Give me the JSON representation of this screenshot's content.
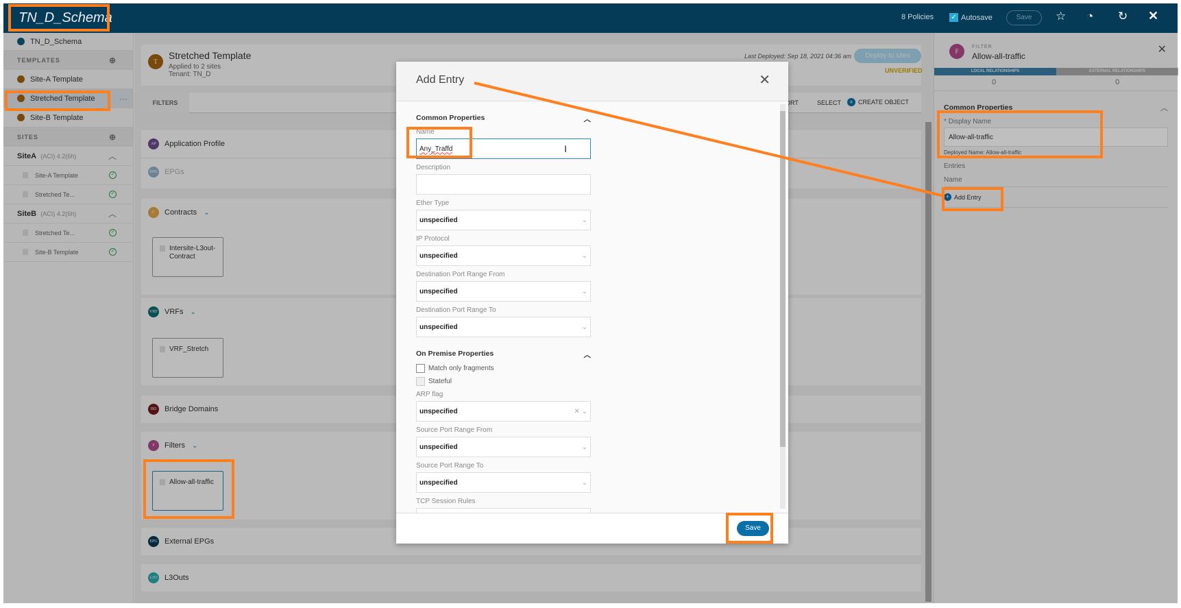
{
  "app": {
    "title": "TN_D_Schema",
    "policies": "8 Policies",
    "autosave_label": "Autosave",
    "autosave_checked": true,
    "save_label": "Save"
  },
  "sidebar": {
    "schema": "TN_D_Schema",
    "templates_header": "TEMPLATES",
    "templates": [
      "Site-A Template",
      "Stretched Template",
      "Site-B Template"
    ],
    "more": "···",
    "sites_header": "SITES",
    "sites": [
      {
        "name": "SiteA",
        "meta": "(ACI)  4.2(6h)",
        "items": [
          "Site-A Template",
          "Stretched Te..."
        ]
      },
      {
        "name": "SiteB",
        "meta": "(ACI)  4.2(6h)",
        "items": [
          "Stretched Te...",
          "Site-B Template"
        ]
      }
    ]
  },
  "main": {
    "template_title": "Stretched Template",
    "applied": "Applied to 2 sites",
    "tenant": "Tenant: TN_D",
    "avatar": "T",
    "last_deployed": "Last Deployed: Sep 18, 2021 04:36 am",
    "deploy_label": "Deploy to sites",
    "status": "UNVERIFIED",
    "tab": "FILTERS",
    "sort": "ORT",
    "select": "SELECT",
    "create": "CREATE OBJECT",
    "sections": {
      "ap": {
        "badge": "AP",
        "label": "Application Profile"
      },
      "epg": {
        "badge": "EPG",
        "label": "EPGs"
      },
      "contracts": {
        "badge": "C",
        "label": "Contracts",
        "obj": "Intersite-L3out-Contract"
      },
      "vrfs": {
        "badge": "VRF",
        "label": "VRFs",
        "obj": "VRF_Stretch"
      },
      "bd": {
        "badge": "BD",
        "label": "Bridge Domains"
      },
      "filters": {
        "badge": "F",
        "label": "Filters",
        "obj": "Allow-all-traffic"
      },
      "ext": {
        "badge": "EPG",
        "label": "External EPGs"
      },
      "l3": {
        "badge": "L3O",
        "label": "L3Outs"
      }
    }
  },
  "right": {
    "avatar": "F",
    "type": "FILTER",
    "name": "Allow-all-traffic",
    "tab_local": "LOCAL RELATIONSHIPS",
    "tab_external": "EXTERNAL RELATIONSHIPS",
    "local_count": "0",
    "external_count": "0",
    "common": "Common Properties",
    "display_name_label": "* Display Name",
    "display_name": "Allow-all-traffic",
    "deployed_name": "Deployed Name: Allow-all-traffic",
    "entries": "Entries",
    "name_col": "Name",
    "add_entry": "Add Entry"
  },
  "modal": {
    "title": "Add Entry",
    "common": "Common Properties",
    "name_label": "Name",
    "name_value": "Any_Traffd",
    "desc_label": "Description",
    "ether_label": "Ether Type",
    "ip_label": "IP Protocol",
    "dst_from_label": "Destination Port Range From",
    "dst_to_label": "Destination Port Range To",
    "onprem": "On Premise Properties",
    "match_frag": "Match only fragments",
    "stateful": "Stateful",
    "arp_label": "ARP flag",
    "src_from_label": "Source Port Range From",
    "src_to_label": "Source Port Range To",
    "tcp_label": "TCP Session Rules",
    "unspecified": "unspecified",
    "save": "Save"
  },
  "colors": {
    "topbar": "#053b56",
    "accent": "#0b6fa8",
    "annotation": "#ff7f1f",
    "warning": "#c9a400"
  }
}
